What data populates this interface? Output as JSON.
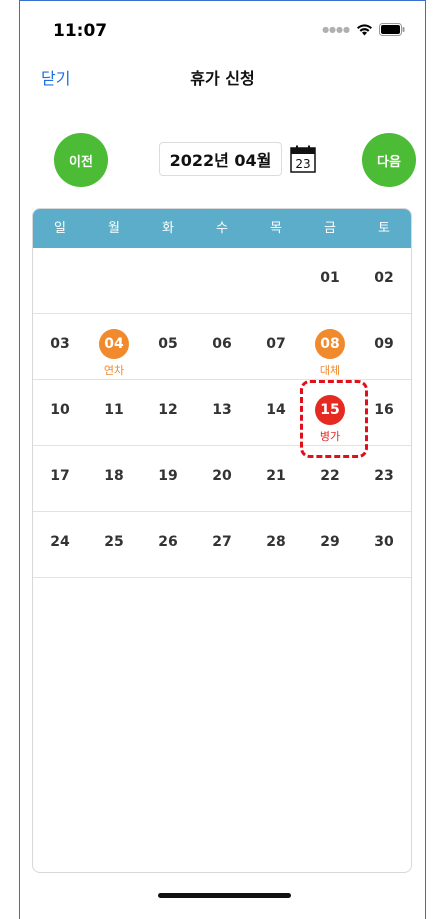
{
  "status": {
    "time": "11:07"
  },
  "nav": {
    "close_label": "닫기",
    "title": "휴가 신청"
  },
  "month_selector": {
    "prev_label": "이전",
    "next_label": "다음",
    "current_month": "2022년 04월",
    "calendar_icon_day": "23"
  },
  "colors": {
    "accent_blue": "#1e6fe6",
    "button_green": "#4cbb35",
    "header_teal": "#5cadc9",
    "annual_leave_orange": "#f08a2c",
    "sick_leave_red": "#e52a21",
    "highlight_dashed": "#e0101a"
  },
  "calendar": {
    "weekdays": [
      "일",
      "월",
      "화",
      "수",
      "목",
      "금",
      "토"
    ],
    "weeks": [
      [
        {
          "day": "",
          "style": "",
          "label": ""
        },
        {
          "day": "",
          "style": "",
          "label": ""
        },
        {
          "day": "",
          "style": "",
          "label": ""
        },
        {
          "day": "",
          "style": "",
          "label": ""
        },
        {
          "day": "",
          "style": "",
          "label": ""
        },
        {
          "day": "01",
          "style": "",
          "label": ""
        },
        {
          "day": "02",
          "style": "",
          "label": ""
        }
      ],
      [
        {
          "day": "03",
          "style": "",
          "label": ""
        },
        {
          "day": "04",
          "style": "orange",
          "label": "연차"
        },
        {
          "day": "05",
          "style": "",
          "label": ""
        },
        {
          "day": "06",
          "style": "",
          "label": ""
        },
        {
          "day": "07",
          "style": "",
          "label": ""
        },
        {
          "day": "08",
          "style": "orange",
          "label": "대체"
        },
        {
          "day": "09",
          "style": "",
          "label": ""
        }
      ],
      [
        {
          "day": "10",
          "style": "",
          "label": ""
        },
        {
          "day": "11",
          "style": "",
          "label": ""
        },
        {
          "day": "12",
          "style": "",
          "label": ""
        },
        {
          "day": "13",
          "style": "",
          "label": ""
        },
        {
          "day": "14",
          "style": "",
          "label": ""
        },
        {
          "day": "15",
          "style": "red",
          "label": "병가"
        },
        {
          "day": "16",
          "style": "",
          "label": ""
        }
      ],
      [
        {
          "day": "17",
          "style": "",
          "label": ""
        },
        {
          "day": "18",
          "style": "",
          "label": ""
        },
        {
          "day": "19",
          "style": "",
          "label": ""
        },
        {
          "day": "20",
          "style": "",
          "label": ""
        },
        {
          "day": "21",
          "style": "",
          "label": ""
        },
        {
          "day": "22",
          "style": "",
          "label": ""
        },
        {
          "day": "23",
          "style": "",
          "label": ""
        }
      ],
      [
        {
          "day": "24",
          "style": "",
          "label": ""
        },
        {
          "day": "25",
          "style": "",
          "label": ""
        },
        {
          "day": "26",
          "style": "",
          "label": ""
        },
        {
          "day": "27",
          "style": "",
          "label": ""
        },
        {
          "day": "28",
          "style": "",
          "label": ""
        },
        {
          "day": "29",
          "style": "",
          "label": ""
        },
        {
          "day": "30",
          "style": "",
          "label": ""
        }
      ]
    ]
  }
}
